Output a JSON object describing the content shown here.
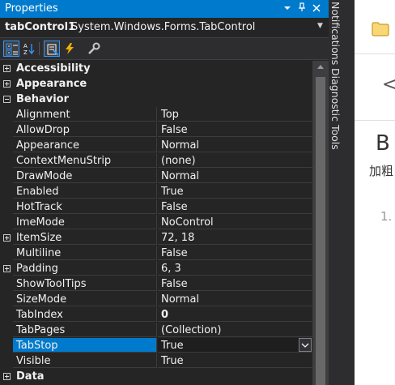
{
  "panel": {
    "title": "Properties",
    "title_icons": [
      "dropdown-icon",
      "pin-icon",
      "close-icon"
    ],
    "object_name": "tabControl1",
    "object_type": "System.Windows.Forms.TabControl"
  },
  "toolbar": {
    "buttons": [
      "categorized-icon",
      "alphabetical-icon",
      "properties-icon",
      "events-icon",
      "property-pages-icon"
    ]
  },
  "grid": {
    "rows": [
      {
        "kind": "category",
        "label": "Accessibility",
        "expanded": false
      },
      {
        "kind": "category",
        "label": "Appearance",
        "expanded": false
      },
      {
        "kind": "category",
        "label": "Behavior",
        "expanded": true
      },
      {
        "kind": "property",
        "label": "Alignment",
        "value": "Top"
      },
      {
        "kind": "property",
        "label": "AllowDrop",
        "value": "False"
      },
      {
        "kind": "property",
        "label": "Appearance",
        "value": "Normal"
      },
      {
        "kind": "property",
        "label": "ContextMenuStrip",
        "value": "(none)"
      },
      {
        "kind": "property",
        "label": "DrawMode",
        "value": "Normal"
      },
      {
        "kind": "property",
        "label": "Enabled",
        "value": "True"
      },
      {
        "kind": "property",
        "label": "HotTrack",
        "value": "False"
      },
      {
        "kind": "property",
        "label": "ImeMode",
        "value": "NoControl"
      },
      {
        "kind": "property",
        "label": "ItemSize",
        "value": "72, 18",
        "expandable": true
      },
      {
        "kind": "property",
        "label": "Multiline",
        "value": "False"
      },
      {
        "kind": "property",
        "label": "Padding",
        "value": "6, 3",
        "expandable": true
      },
      {
        "kind": "property",
        "label": "ShowToolTips",
        "value": "False"
      },
      {
        "kind": "property",
        "label": "SizeMode",
        "value": "Normal"
      },
      {
        "kind": "property",
        "label": "TabIndex",
        "value": "0",
        "bold": true
      },
      {
        "kind": "property",
        "label": "TabPages",
        "value": "(Collection)"
      },
      {
        "kind": "property",
        "label": "TabStop",
        "value": "True",
        "selected": true
      },
      {
        "kind": "property",
        "label": "Visible",
        "value": "True"
      },
      {
        "kind": "category",
        "label": "Data",
        "expanded": false
      }
    ]
  },
  "side_tabs": [
    "Notifications",
    "Diagnostic Tools"
  ],
  "right_pane": {
    "back_glyph": "<",
    "heading": "B",
    "cn_text": "加粗",
    "list_number": "1."
  },
  "colors": {
    "accent": "#007acc",
    "background": "#252526",
    "text": "#f1f1f1"
  }
}
